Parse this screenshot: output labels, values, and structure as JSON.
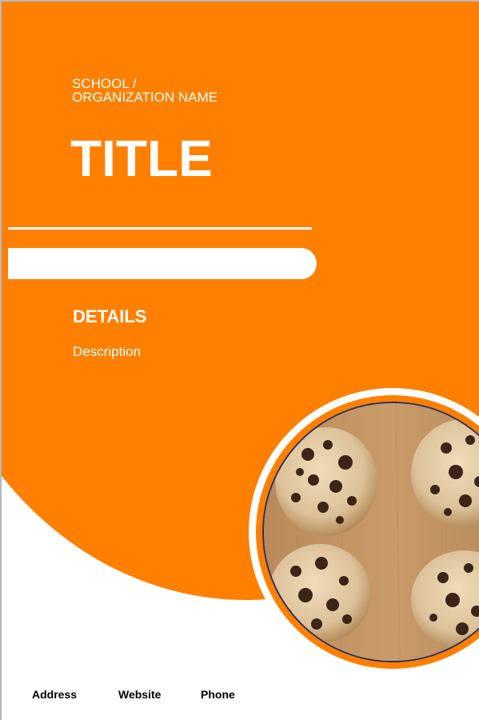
{
  "header": {
    "organization": "SCHOOL /\nORGANIZATION NAME",
    "title": "TITLE"
  },
  "body": {
    "details_heading": "DETAILS",
    "description": "Description"
  },
  "footer": {
    "address": "Address",
    "website": "Website",
    "phone": "Phone"
  },
  "colors": {
    "accent": "#ff7f00",
    "text_light": "#ffffff",
    "text_dark": "#000000",
    "photo_border": "#25346b"
  },
  "image": {
    "subject": "chocolate-chip-cookies-photo"
  }
}
